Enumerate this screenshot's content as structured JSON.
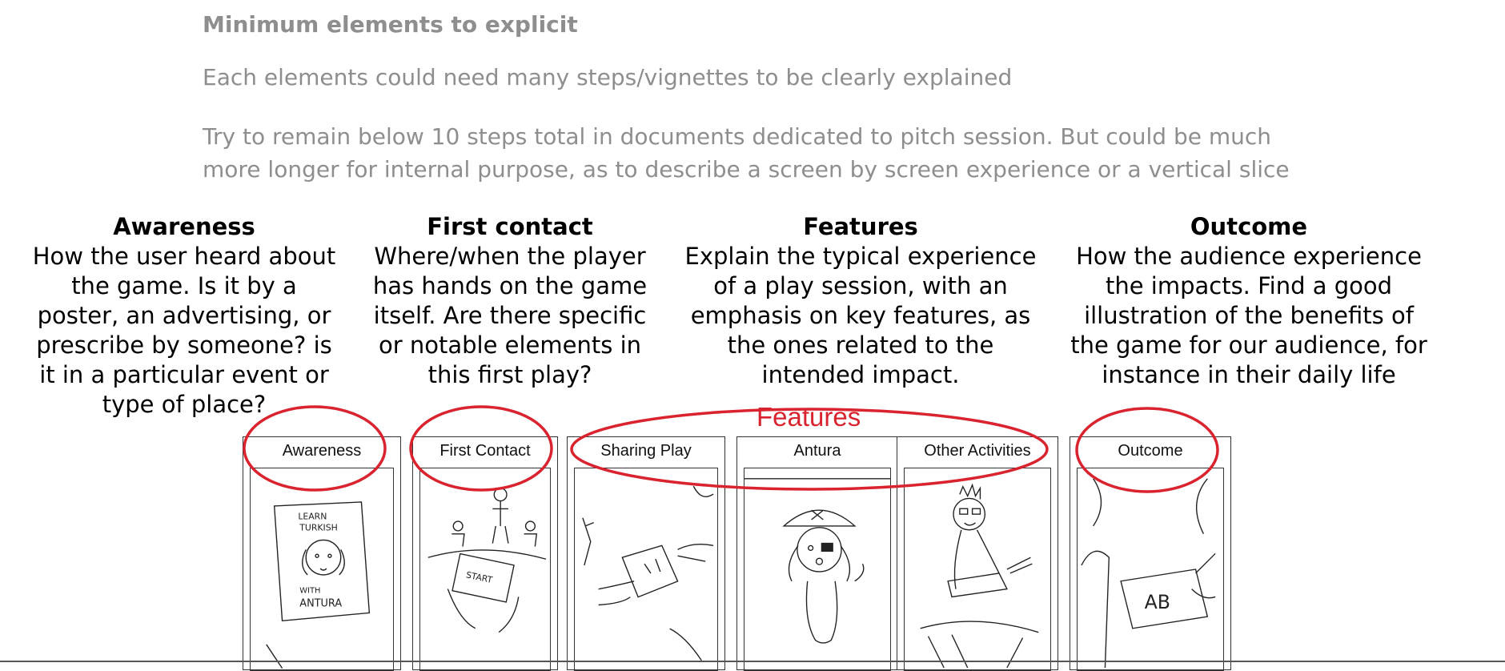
{
  "intro": {
    "heading": "Minimum elements to explicit",
    "line1": "Each elements could need many steps/vignettes to be clearly explained",
    "line2": "Try to remain below 10 steps total in documents dedicated to pitch session. But could be much more longer for internal purpose, as to describe a screen by screen experience or a vertical slice"
  },
  "columns": [
    {
      "title": "Awareness",
      "body": "How the user heard about the game. Is it by a poster, an advertising, or prescribe by someone? is it in a particular event or type of place?"
    },
    {
      "title": "First contact",
      "body": "Where/when the player has hands on the game itself. Are there specific or notable elements in this first play?"
    },
    {
      "title": "Features",
      "body": "Explain the typical experience of a play session, with an emphasis on key features, as the ones related to the intended impact."
    },
    {
      "title": "Outcome",
      "body": "How the audience experience the impacts.  Find a good illustration of the benefits of the game for our audience, for instance in their daily life"
    }
  ],
  "storyboard": {
    "features_annotation": "Features",
    "panels": [
      {
        "label": "Awareness",
        "sketch": "poster-sketch"
      },
      {
        "label": "First Contact",
        "sketch": "tablet-sketch"
      },
      {
        "label": "Sharing Play",
        "sketch": "hands-sketch"
      },
      {
        "label": "Antura",
        "sketch": "dog-pirate-sketch"
      },
      {
        "label": "Other Activities",
        "sketch": "person-reading-sketch"
      },
      {
        "label": "Outcome",
        "sketch": "writing-sketch"
      }
    ],
    "poster_text": [
      "LEARN",
      "TURKISH",
      "WITH",
      "ANTURA"
    ],
    "tablet_text": "START"
  },
  "colors": {
    "annotation": "#d9232f",
    "intro_text": "#8e8e8e"
  }
}
